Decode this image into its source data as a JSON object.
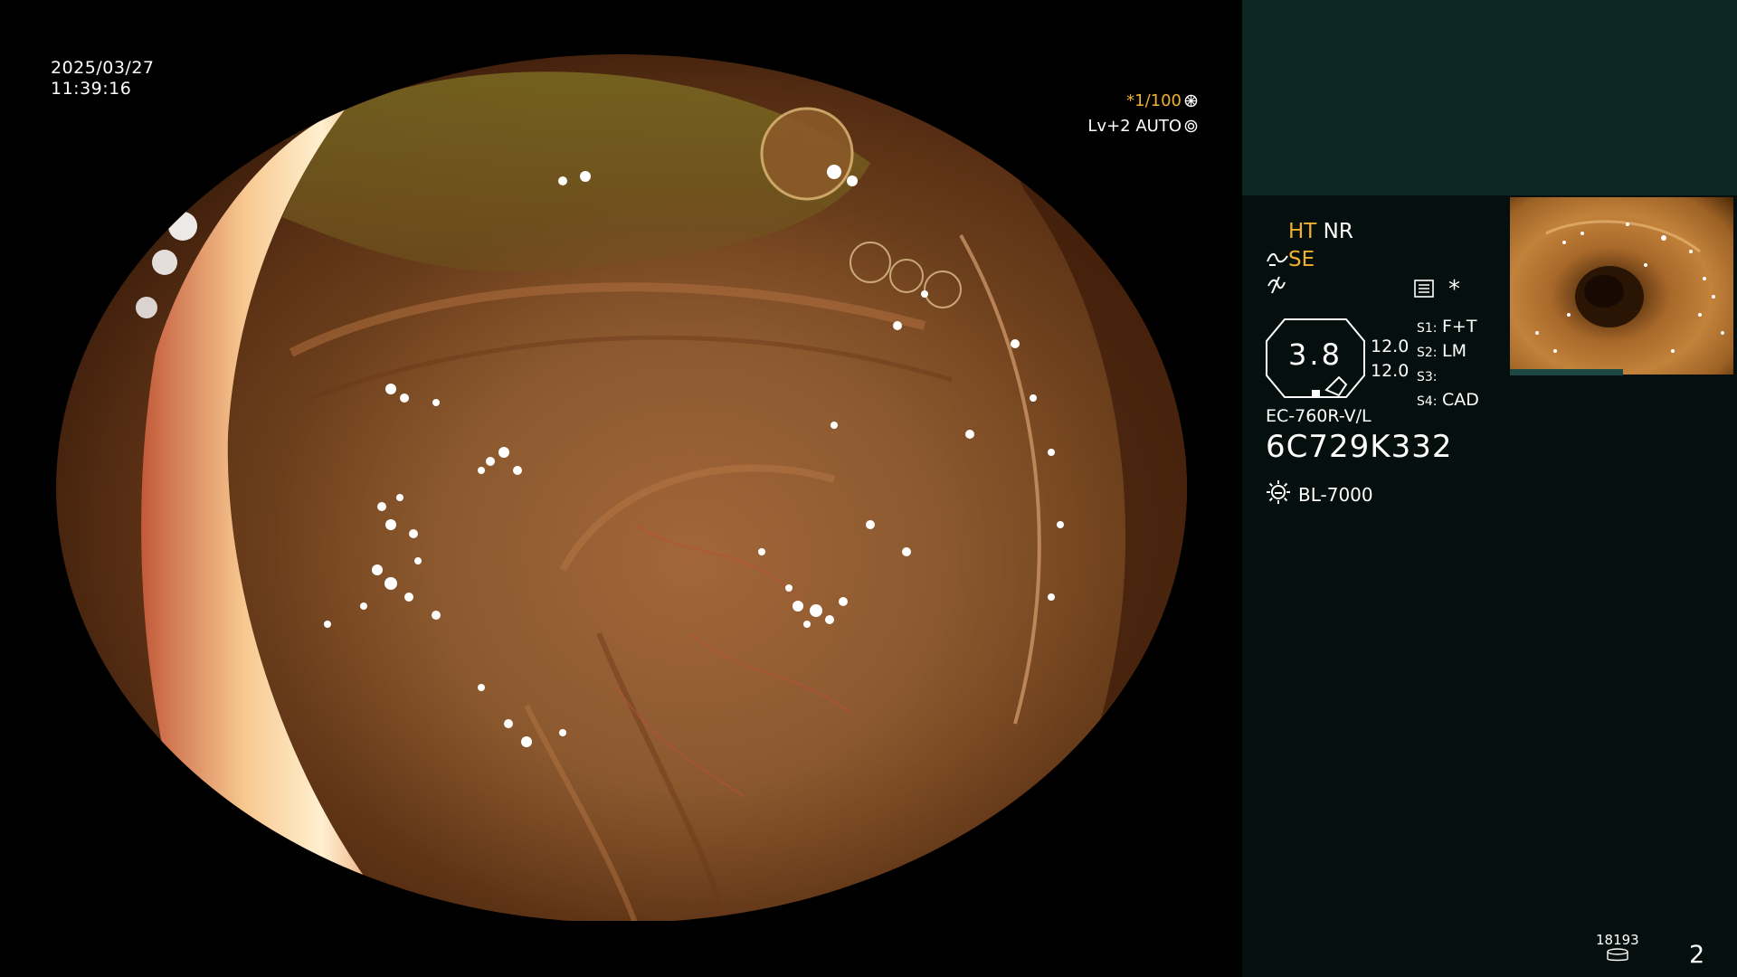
{
  "datetime": {
    "date": "2025/03/27",
    "time": "11:39:16"
  },
  "scope_overlay": {
    "shutter": "*1/100",
    "level": "Lv+2",
    "exposure": "AUTO"
  },
  "panel": {
    "mode_ht": "HT",
    "mode_nr": "NR",
    "mode_se": "SE",
    "icon_note": "*",
    "brightness": "3.8",
    "gain_top": "12.0",
    "gain_bottom": "12.0",
    "switches": [
      {
        "key": "S1:",
        "value": "F+T"
      },
      {
        "key": "S2:",
        "value": "LM"
      },
      {
        "key": "S3:",
        "value": ""
      },
      {
        "key": "S4:",
        "value": "CAD"
      }
    ],
    "scope_model": "EC-760R-V/L",
    "scope_serial": "6C729K332",
    "light_source": "BL-7000"
  },
  "storage": {
    "count": "18193"
  },
  "page_number": "2",
  "colors": {
    "accent": "#f0b030",
    "panel_bg": "#05100e",
    "panel_top": "#0d2724",
    "text": "#ffffff"
  }
}
